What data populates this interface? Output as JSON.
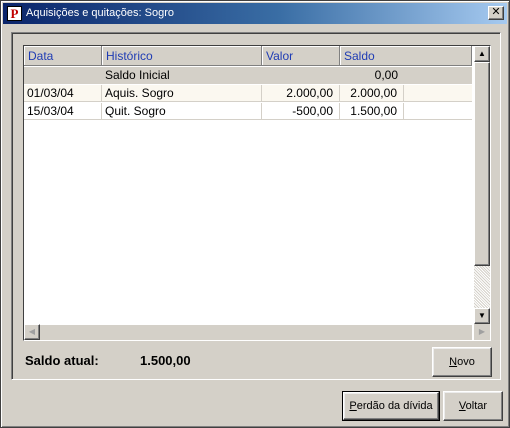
{
  "window": {
    "title": "Aquisições e quitações: Sogro",
    "app_icon_glyph": "P",
    "close_glyph": "✕"
  },
  "grid": {
    "columns": [
      "Data",
      "Histórico",
      "Valor",
      "Saldo"
    ],
    "initial_row": {
      "label": "Saldo Inicial",
      "saldo": "0,00"
    },
    "rows": [
      {
        "data": "01/03/04",
        "historico": "Aquis. Sogro",
        "valor": "2.000,00",
        "saldo": "2.000,00"
      },
      {
        "data": "15/03/04",
        "historico": "Quit. Sogro",
        "valor": "-500,00",
        "saldo": "1.500,00"
      }
    ],
    "scroll_up_glyph": "▲",
    "scroll_down_glyph": "▼",
    "scroll_left_glyph": "◀",
    "scroll_right_glyph": "▶"
  },
  "summary": {
    "label": "Saldo atual:",
    "value": "1.500,00"
  },
  "buttons": {
    "novo": {
      "accel": "N",
      "rest": "ovo"
    },
    "perdao": {
      "accel": "P",
      "rest": "erdão da dívida"
    },
    "voltar": {
      "accel": "V",
      "rest": "oltar"
    }
  },
  "colors": {
    "title_gradient_start": "#0a246a",
    "title_gradient_end": "#a6caf0",
    "header_text": "#1f3cb4",
    "window_face": "#d4d0c8"
  }
}
